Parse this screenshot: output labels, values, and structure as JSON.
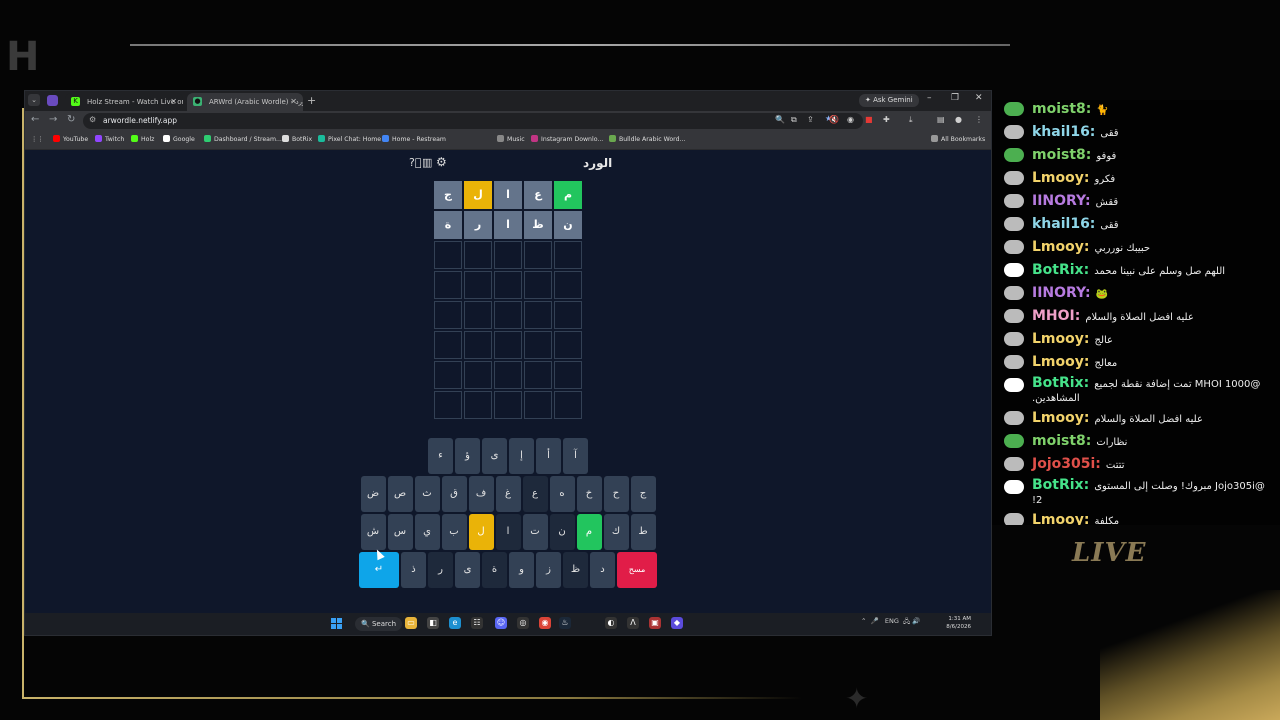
{
  "browser": {
    "tabs": [
      {
        "title": "Holz Stream - Watch Live on K",
        "favicon": "kick-icon"
      },
      {
        "title": "ARWrd (Arabic Wordle) - الورد",
        "favicon": "globe-icon"
      }
    ],
    "ask_gemini": "Ask Gemini",
    "url": "arwordle.netlify.app",
    "bookmarks": [
      "YouTube",
      "Twitch",
      "Holz",
      "Google",
      "Dashboard / Stream...",
      "BotRix",
      "Pixel Chat: Home",
      "Home - Restream",
      "Music",
      "Instagram Downlo...",
      "Bulldle Arabic Word..."
    ],
    "all_bookmarks": "All Bookmarks",
    "window_controls": {
      "minimize": "–",
      "maximize": "❐",
      "close": "✕"
    }
  },
  "game": {
    "title": "الورد",
    "board": [
      [
        {
          "l": "م",
          "s": "correct"
        },
        {
          "l": "ع",
          "s": "absent"
        },
        {
          "l": "ا",
          "s": "absent"
        },
        {
          "l": "ل",
          "s": "present"
        },
        {
          "l": "ج",
          "s": "absent"
        }
      ],
      [
        {
          "l": "ن",
          "s": "absent"
        },
        {
          "l": "ظ",
          "s": "absent"
        },
        {
          "l": "ا",
          "s": "absent"
        },
        {
          "l": "ر",
          "s": "absent"
        },
        {
          "l": "ة",
          "s": "absent"
        }
      ],
      [
        {
          "l": "",
          "s": "empty"
        },
        {
          "l": "",
          "s": "empty"
        },
        {
          "l": "",
          "s": "empty"
        },
        {
          "l": "",
          "s": "empty"
        },
        {
          "l": "",
          "s": "empty"
        }
      ],
      [
        {
          "l": "",
          "s": "empty"
        },
        {
          "l": "",
          "s": "empty"
        },
        {
          "l": "",
          "s": "empty"
        },
        {
          "l": "",
          "s": "empty"
        },
        {
          "l": "",
          "s": "empty"
        }
      ],
      [
        {
          "l": "",
          "s": "empty"
        },
        {
          "l": "",
          "s": "empty"
        },
        {
          "l": "",
          "s": "empty"
        },
        {
          "l": "",
          "s": "empty"
        },
        {
          "l": "",
          "s": "empty"
        }
      ],
      [
        {
          "l": "",
          "s": "empty"
        },
        {
          "l": "",
          "s": "empty"
        },
        {
          "l": "",
          "s": "empty"
        },
        {
          "l": "",
          "s": "empty"
        },
        {
          "l": "",
          "s": "empty"
        }
      ],
      [
        {
          "l": "",
          "s": "empty"
        },
        {
          "l": "",
          "s": "empty"
        },
        {
          "l": "",
          "s": "empty"
        },
        {
          "l": "",
          "s": "empty"
        },
        {
          "l": "",
          "s": "empty"
        }
      ],
      [
        {
          "l": "",
          "s": "empty"
        },
        {
          "l": "",
          "s": "empty"
        },
        {
          "l": "",
          "s": "empty"
        },
        {
          "l": "",
          "s": "empty"
        },
        {
          "l": "",
          "s": "empty"
        }
      ]
    ],
    "keyboard": [
      [
        {
          "k": "آ",
          "s": ""
        },
        {
          "k": "أ",
          "s": ""
        },
        {
          "k": "إ",
          "s": ""
        },
        {
          "k": "ى",
          "s": ""
        },
        {
          "k": "ؤ",
          "s": ""
        },
        {
          "k": "ء",
          "s": ""
        }
      ],
      [
        {
          "k": "ج",
          "s": ""
        },
        {
          "k": "ح",
          "s": ""
        },
        {
          "k": "خ",
          "s": ""
        },
        {
          "k": "ه",
          "s": ""
        },
        {
          "k": "ع",
          "s": "absent"
        },
        {
          "k": "غ",
          "s": ""
        },
        {
          "k": "ف",
          "s": ""
        },
        {
          "k": "ق",
          "s": ""
        },
        {
          "k": "ث",
          "s": ""
        },
        {
          "k": "ص",
          "s": ""
        },
        {
          "k": "ض",
          "s": ""
        }
      ],
      [
        {
          "k": "ط",
          "s": ""
        },
        {
          "k": "ك",
          "s": ""
        },
        {
          "k": "م",
          "s": "correct"
        },
        {
          "k": "ن",
          "s": "absent"
        },
        {
          "k": "ت",
          "s": ""
        },
        {
          "k": "ا",
          "s": "absent"
        },
        {
          "k": "ل",
          "s": "present"
        },
        {
          "k": "ب",
          "s": ""
        },
        {
          "k": "ي",
          "s": ""
        },
        {
          "k": "س",
          "s": ""
        },
        {
          "k": "ش",
          "s": ""
        }
      ],
      [
        {
          "k": "مسح",
          "s": "wide-red"
        },
        {
          "k": "د",
          "s": ""
        },
        {
          "k": "ظ",
          "s": "absent"
        },
        {
          "k": "ز",
          "s": ""
        },
        {
          "k": "و",
          "s": ""
        },
        {
          "k": "ة",
          "s": "absent"
        },
        {
          "k": "ى",
          "s": ""
        },
        {
          "k": "ر",
          "s": "absent"
        },
        {
          "k": "ذ",
          "s": ""
        },
        {
          "k": "↵",
          "s": "wide-blue"
        }
      ]
    ]
  },
  "taskbar": {
    "search": "Search",
    "tray": "ENG",
    "time": "1:31 AM",
    "date": "8/6/2026"
  },
  "overlay": {
    "live_label": "LIVE"
  },
  "chat": [
    {
      "user": "moist8:",
      "color": "#7fd16b",
      "text": "🐈"
    },
    {
      "user": "khail16:",
      "color": "#8fd6e8",
      "text": "ققى"
    },
    {
      "user": "moist8:",
      "color": "#7fd16b",
      "text": "فوفو"
    },
    {
      "user": "Lmooy:",
      "color": "#f2d36b",
      "text": "فكرو"
    },
    {
      "user": "IINORY:",
      "color": "#b77be0",
      "text": "ققش"
    },
    {
      "user": "khail16:",
      "color": "#8fd6e8",
      "text": "ققى"
    },
    {
      "user": "Lmooy:",
      "color": "#f2d36b",
      "text": "حبيبك نورربي"
    },
    {
      "user": "BotRix:",
      "color": "#46e38a",
      "text": "اللهم صل وسلم على نبينا محمد"
    },
    {
      "user": "IINORY:",
      "color": "#b77be0",
      "text": "🐸"
    },
    {
      "user": "MHOI:",
      "color": "#f0a0c8",
      "text": "عليه افضل الصلاة والسلام"
    },
    {
      "user": "Lmooy:",
      "color": "#f2d36b",
      "text": "عالج"
    },
    {
      "user": "Lmooy:",
      "color": "#f2d36b",
      "text": "معالج"
    },
    {
      "user": "BotRix:",
      "color": "#46e38a",
      "text": "@MHOI 1000 تمت إضافة نقطة لجميع المشاهدين."
    },
    {
      "user": "Lmooy:",
      "color": "#f2d36b",
      "text": "عليه افضل الصلاة والسلام"
    },
    {
      "user": "moist8:",
      "color": "#7fd16b",
      "text": "نظارات"
    },
    {
      "user": "Jojo305i:",
      "color": "#e0504a",
      "text": "تتتت"
    },
    {
      "user": "BotRix:",
      "color": "#46e38a",
      "text": "@Jojo305i مبروك! وصلت إلى المستوى 2!"
    },
    {
      "user": "Lmooy:",
      "color": "#f2d36b",
      "text": "مكلفة"
    }
  ]
}
